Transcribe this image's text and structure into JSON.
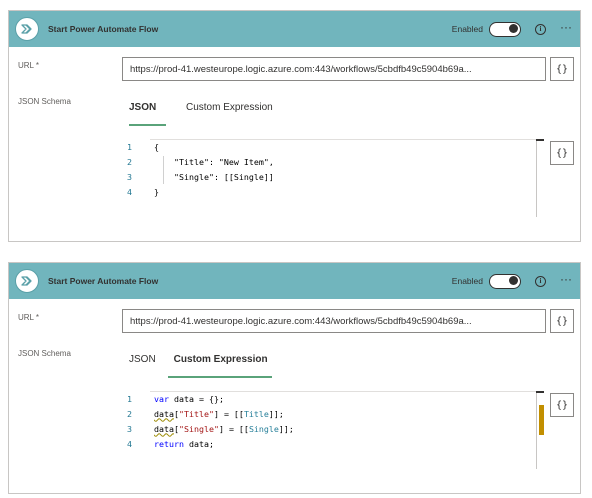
{
  "card1": {
    "header": {
      "title": "Start Power Automate Flow",
      "enabled_label": "Enabled",
      "info_glyph": "i",
      "more_glyph": "···",
      "color": "#71b5bd"
    },
    "url": {
      "label": "URL *",
      "value": "https://prod-41.westeurope.logic.azure.com:443/workflows/5cbdfb49c5904b69a..."
    },
    "schema": {
      "label": "JSON Schema"
    },
    "tabs": [
      {
        "label": "JSON",
        "active": true
      },
      {
        "label": "Custom Expression",
        "active": false
      }
    ],
    "brace_label": "{}",
    "code": [
      {
        "n": "1",
        "text": "{"
      },
      {
        "n": "2",
        "text": "    \"Title\": \"New Item\","
      },
      {
        "n": "3",
        "text": "    \"Single\": [[Single]]"
      },
      {
        "n": "4",
        "text": "}"
      }
    ]
  },
  "card2": {
    "header": {
      "title": "Start Power Automate Flow",
      "enabled_label": "Enabled",
      "info_glyph": "i",
      "more_glyph": "···",
      "color": "#71b5bd"
    },
    "url": {
      "label": "URL *",
      "value": "https://prod-41.westeurope.logic.azure.com:443/workflows/5cbdfb49c5904b69a..."
    },
    "schema": {
      "label": "JSON Schema"
    },
    "tabs": [
      {
        "label": "JSON",
        "active": false
      },
      {
        "label": "Custom Expression",
        "active": true
      }
    ],
    "brace_label": "{}",
    "code": [
      {
        "n": "1",
        "kw": "var",
        "rest": " data = {};"
      },
      {
        "n": "2",
        "p1": "data",
        "p2": "[",
        "s1": "\"Title\"",
        "p3": "] = [[",
        "v1": "Title",
        "p4": "]];"
      },
      {
        "n": "3",
        "p1": "data",
        "p2": "[",
        "s1": "\"Single\"",
        "p3": "] = [[",
        "v1": "Single",
        "p4": "]];"
      },
      {
        "n": "4",
        "kw": "return",
        "rest": " data;"
      }
    ]
  }
}
